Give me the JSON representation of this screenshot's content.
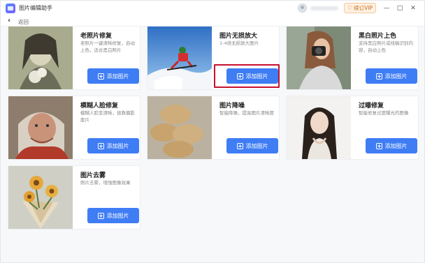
{
  "app": {
    "title": "图片编辑助手"
  },
  "header": {
    "vip_label": "续订VIP",
    "minimize": "—",
    "maximize": "□",
    "close": "✕"
  },
  "nav": {
    "back_label": "返回"
  },
  "cards": [
    {
      "title": "老照片修复",
      "desc": "老照片一键清晰修复，自动上色，适合黑白照片",
      "button": "添加图片"
    },
    {
      "title": "图片无损放大",
      "desc": "1-4倍无损放大图片",
      "button": "添加图片"
    },
    {
      "title": "黑白照片上色",
      "desc": "支持黑白照片或线稿识别内容，自动上色",
      "button": "添加图片"
    },
    {
      "title": "模糊人脸修复",
      "desc": "模糊人脸变清晰，拯救摄影废片",
      "button": "添加图片"
    },
    {
      "title": "图片降噪",
      "desc": "智能降噪，提高图片清晰度",
      "button": "添加图片"
    },
    {
      "title": "过曝修复",
      "desc": "智能修复过度曝光的图像",
      "button": "添加图片"
    },
    {
      "title": "图片去雾",
      "desc": "照片去雾，增强图像效果",
      "button": "添加图片"
    }
  ],
  "colors": {
    "accent": "#3f7df5",
    "highlight": "#c8102e",
    "vip": "#c66a1a"
  }
}
